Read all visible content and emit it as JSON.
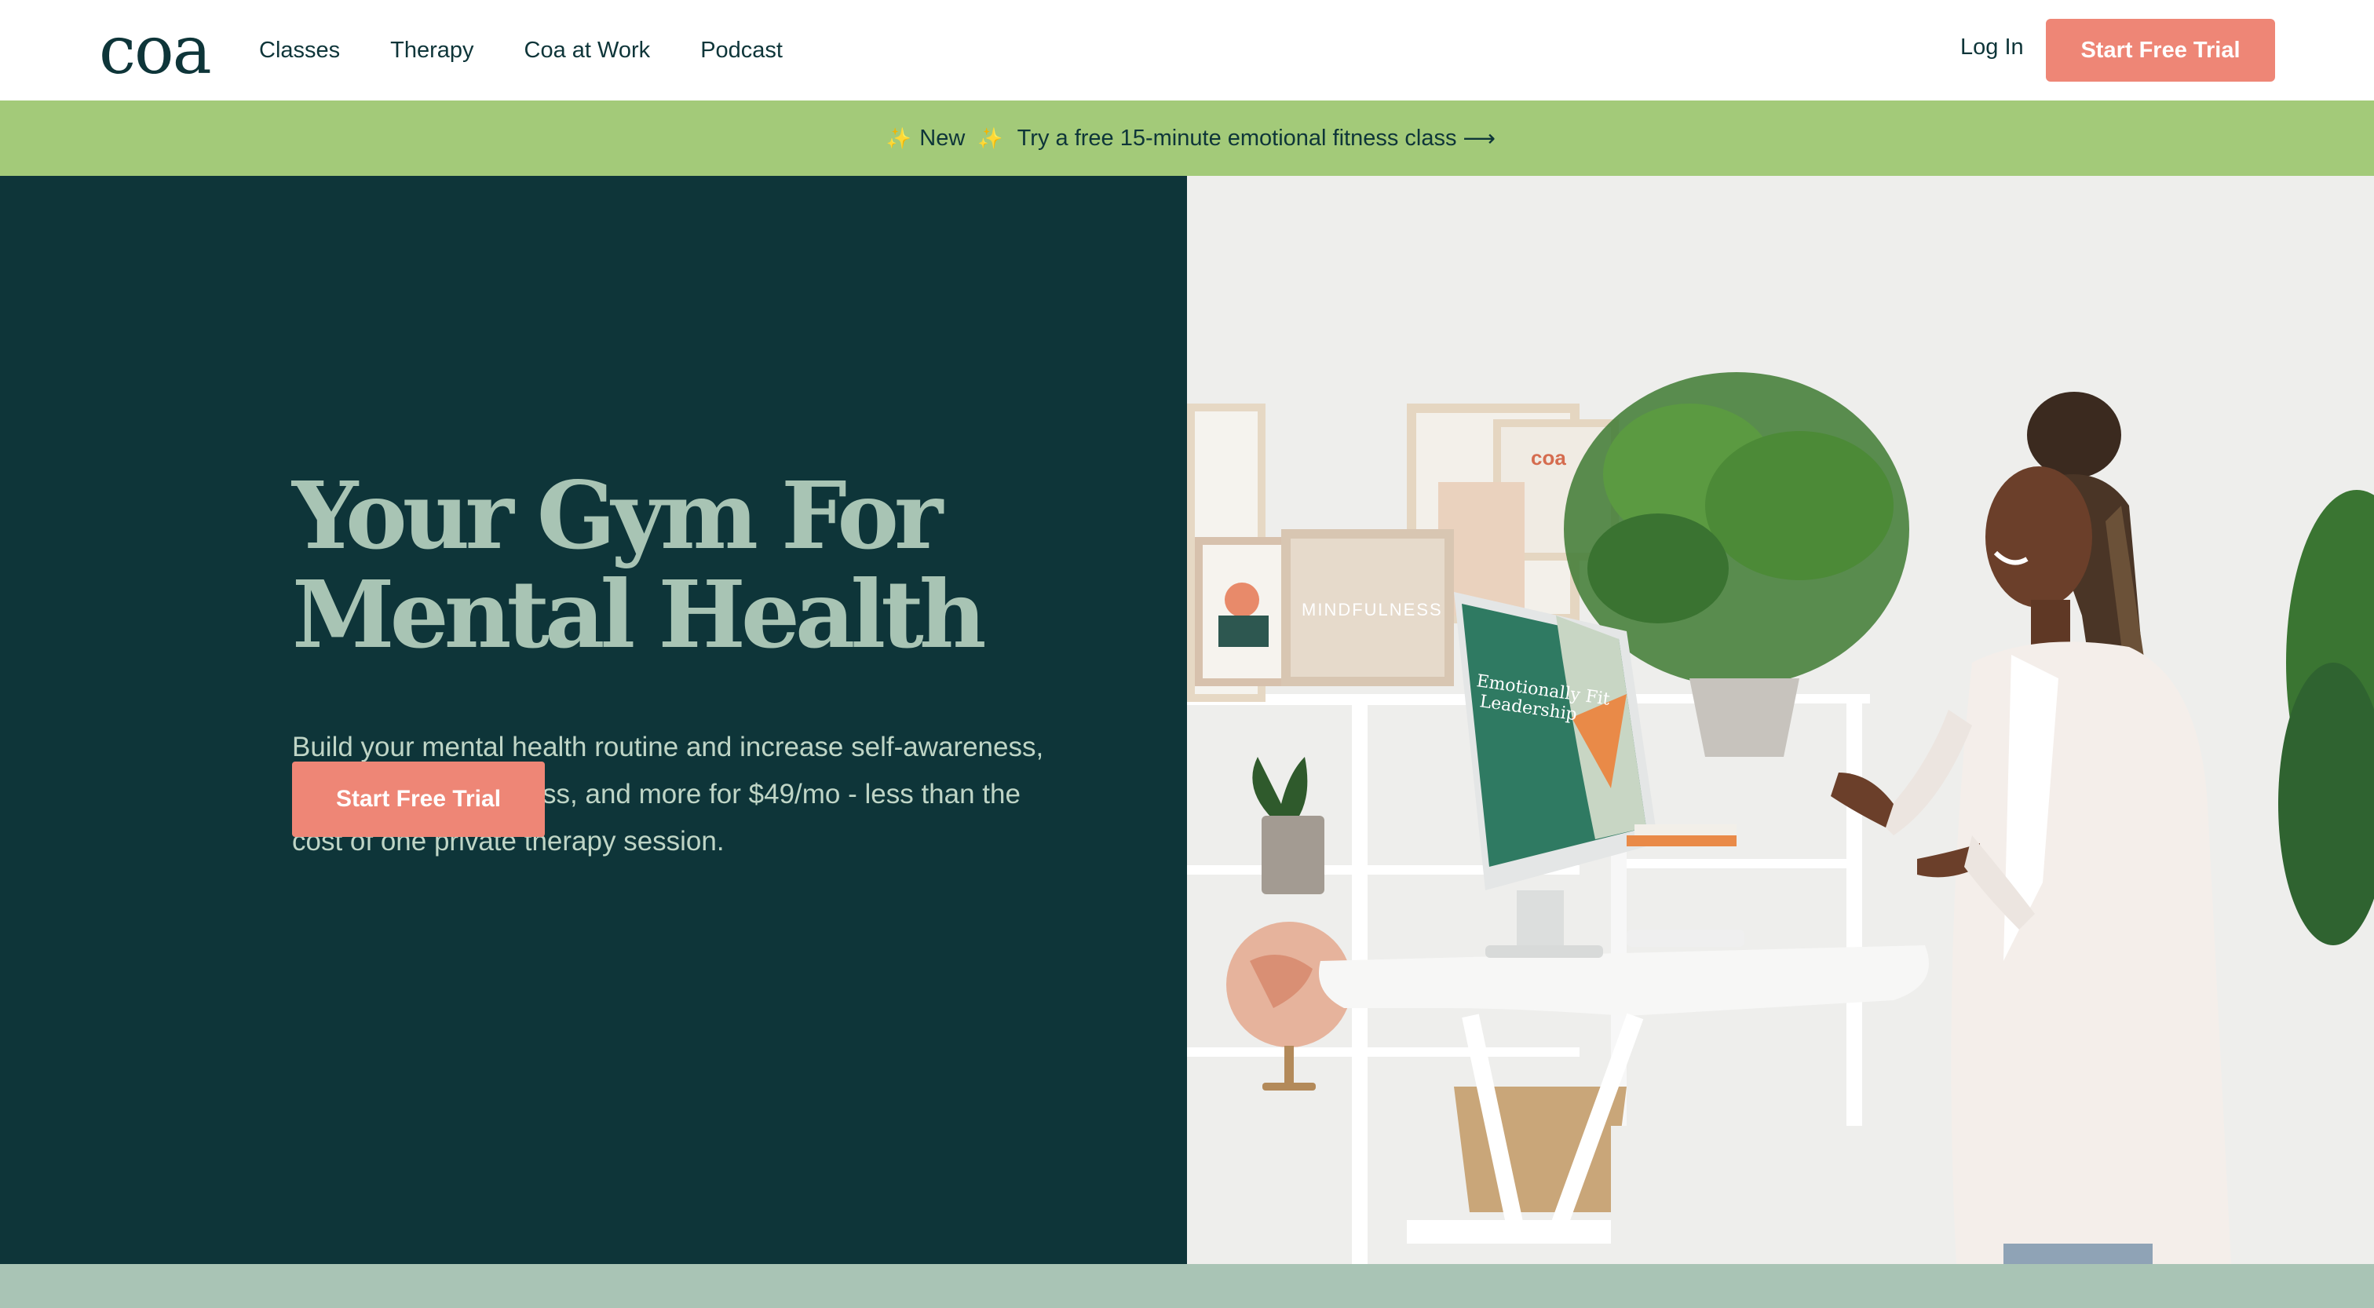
{
  "header": {
    "logo": "coa",
    "nav": [
      {
        "label": "Classes"
      },
      {
        "label": "Therapy"
      },
      {
        "label": "Coa at Work"
      },
      {
        "label": "Podcast"
      }
    ],
    "login_label": "Log In",
    "cta_label": "Start Free Trial"
  },
  "banner": {
    "new_label": "New",
    "text": "Try a free 15-minute emotional fitness class",
    "arrow": "⟶"
  },
  "hero": {
    "title_line1": "Your Gym For",
    "title_line2": "Mental Health",
    "description": "Build your mental health routine and increase self-awareness, resilience, mindfulness, and more for $49/mo - less than the cost of one private therapy session.",
    "cta_label": "Start Free Trial",
    "photo": {
      "monitor_title": "Emotionally Fit Leadership",
      "frame_sign": "MINDFULNESS",
      "poster_logo": "coa"
    }
  },
  "colors": {
    "dark_teal": "#0e3539",
    "coral": "#ee8676",
    "banner_green": "#a3ca79",
    "sage": "#a9c4b5"
  }
}
